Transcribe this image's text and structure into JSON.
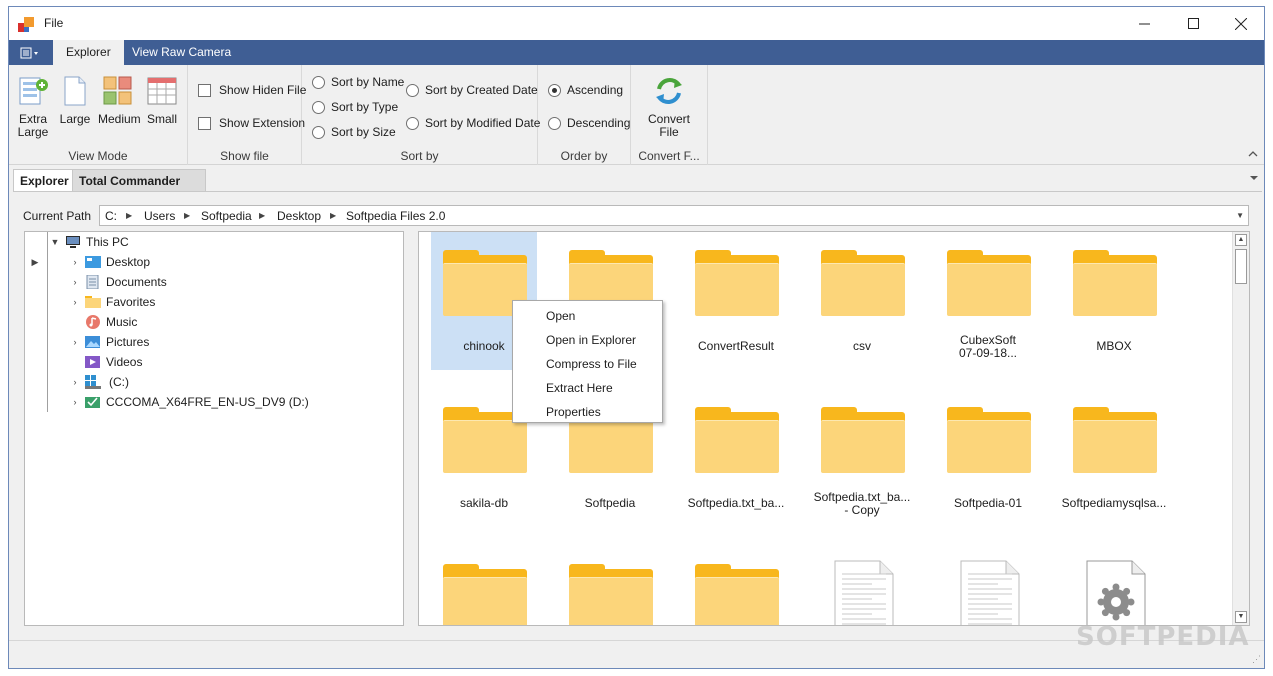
{
  "window": {
    "title": "File"
  },
  "ribbon": {
    "tabs": [
      {
        "label": "Explorer",
        "active": true
      },
      {
        "label": "View Raw Camera",
        "active": false
      }
    ],
    "view_mode": {
      "label": "View Mode",
      "buttons": [
        {
          "label": "Extra Large",
          "line1": "Extra",
          "line2": "Large"
        },
        {
          "label": "Large"
        },
        {
          "label": "Medium"
        },
        {
          "label": "Small"
        }
      ]
    },
    "show_file": {
      "label": "Show file",
      "options": [
        {
          "label": "Show Hiden File",
          "checked": false
        },
        {
          "label": "Show Extension",
          "checked": false
        }
      ]
    },
    "sort_by": {
      "label": "Sort by",
      "options": [
        {
          "label": "Sort by Name",
          "selected": false
        },
        {
          "label": "Sort by Type",
          "selected": false
        },
        {
          "label": "Sort by Size",
          "selected": false
        },
        {
          "label": "Sort by Created Date",
          "selected": false
        },
        {
          "label": "Sort by Modified Date",
          "selected": false
        }
      ]
    },
    "order_by": {
      "label": "Order by",
      "options": [
        {
          "label": "Ascending",
          "selected": true
        },
        {
          "label": "Descending",
          "selected": false
        }
      ]
    },
    "convert": {
      "label": "Convert F...",
      "button_line1": "Convert",
      "button_line2": "File"
    }
  },
  "doc_tabs": [
    {
      "label": "Explorer",
      "active": true
    },
    {
      "label": "Total Commander",
      "active": false
    }
  ],
  "path": {
    "label": "Current Path",
    "crumbs": [
      "C:",
      "Users",
      "Softpedia",
      "Desktop",
      "Softpedia Files 2.0"
    ]
  },
  "tree": {
    "root": "This PC",
    "children": [
      "Desktop",
      "Documents",
      "Favorites",
      "Music",
      "Pictures",
      "Videos",
      "(C:)",
      "CCCOMA_X64FRE_EN-US_DV9 (D:)"
    ]
  },
  "files": [
    {
      "name": "chinook",
      "type": "folder",
      "selected": true
    },
    {
      "name": "",
      "type": "folder"
    },
    {
      "name": "ConvertResult",
      "type": "folder"
    },
    {
      "name": "csv",
      "type": "folder"
    },
    {
      "name": "CubexSoft 07-09-18...",
      "line1": "CubexSoft",
      "line2": "07-09-18...",
      "type": "folder"
    },
    {
      "name": "MBOX",
      "type": "folder"
    },
    {
      "name": "sakila-db",
      "type": "folder"
    },
    {
      "name": "Softpedia",
      "type": "folder"
    },
    {
      "name": "Softpedia.txt_ba...",
      "type": "folder"
    },
    {
      "name": "Softpedia.txt_ba... - Copy",
      "line1": "Softpedia.txt_ba...",
      "line2": "- Copy",
      "type": "folder"
    },
    {
      "name": "Softpedia-01",
      "type": "folder"
    },
    {
      "name": "Softpediamysqlsa...",
      "type": "folder"
    }
  ],
  "context_menu": [
    "Open",
    "Open in Explorer",
    "Compress to File",
    "Extract Here",
    "Properties"
  ],
  "watermark": "SOFTPEDIA",
  "colors": {
    "ribbon_tab_bar": "#3f5e94",
    "folder_back": "#f8b71d",
    "folder_front": "#fcd57a",
    "selection": "#cce0f5"
  }
}
